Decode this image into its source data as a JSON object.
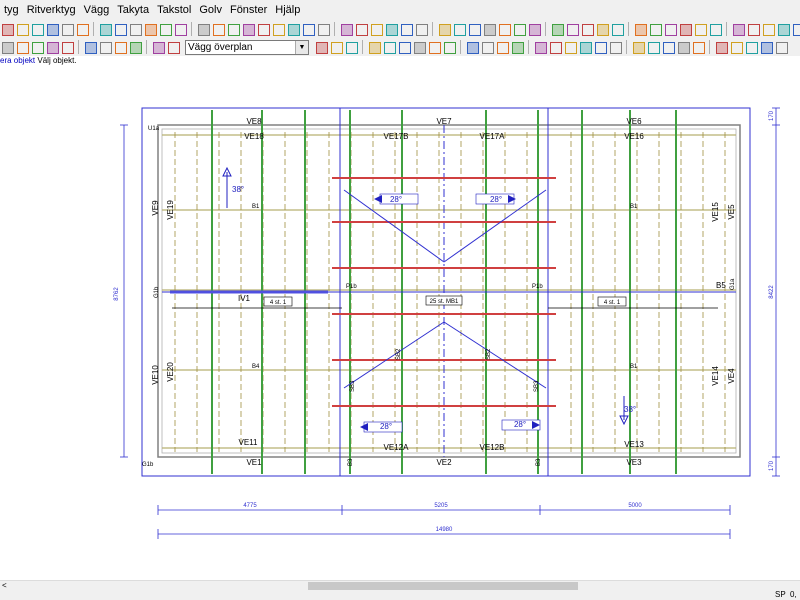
{
  "menu": [
    "tyg",
    "Ritverktyg",
    "Vägg",
    "Takyta",
    "Takstol",
    "Golv",
    "Fönster",
    "Hjälp"
  ],
  "toolbar": {
    "view_select_value": "Vägg överplan"
  },
  "status": {
    "prompt_link": "era objekt",
    "prompt_text": "Välj objekt."
  },
  "bottom": {
    "sp_label": "SP",
    "value": "0,"
  },
  "drawing": {
    "wall_labels": {
      "ve8": "VE8",
      "ve7": "VE7",
      "ve6": "VE6",
      "ve18": "VE18",
      "ve17b": "VE17B",
      "ve17a": "VE17A",
      "ve16": "VE16",
      "ve9": "VE9",
      "ve19": "VE19",
      "ve15": "VE15",
      "ve5": "VE5",
      "ve10": "VE10",
      "ve20": "VE20",
      "ve14": "VE14",
      "ve4": "VE4",
      "ve11": "VE11",
      "ve12a": "VE12A",
      "ve12b": "VE12B",
      "ve13": "VE13",
      "ve1": "VE1",
      "ve2": "VE2",
      "ve3": "VE3",
      "iv1": "IV1"
    },
    "small_labels": {
      "u1a": "U1a",
      "g1b": "G1b",
      "g1a": "G1a",
      "g1b_bottom": "G1b",
      "b1_left": "B1",
      "b1_right": "B1",
      "b4": "B4",
      "b1_right2": "B1",
      "b5": "B5",
      "b3_left": "B3",
      "b3_right": "B3",
      "p1b_left": "P1b",
      "p1b_right": "P1b",
      "sb3_left": "SB3",
      "sb3_right": "SB3",
      "sb2_left": "SB2",
      "sb2_right": "SB2"
    },
    "beam_labels": {
      "left": "4 st. 1",
      "center": "25 st. MB1",
      "right": "4 st. 1"
    },
    "slope_labels": {
      "top_left": "28°",
      "top_right": "28°",
      "bottom_left": "28°",
      "bottom_right": "28°",
      "side_left": "38°",
      "side_right": "38°"
    },
    "dimensions": {
      "left_height": "8762",
      "right_height": "8422",
      "right_top": "170",
      "right_bottom": "170",
      "seg1": "4775",
      "seg2": "5205",
      "seg3": "5000",
      "total": "14980"
    }
  }
}
